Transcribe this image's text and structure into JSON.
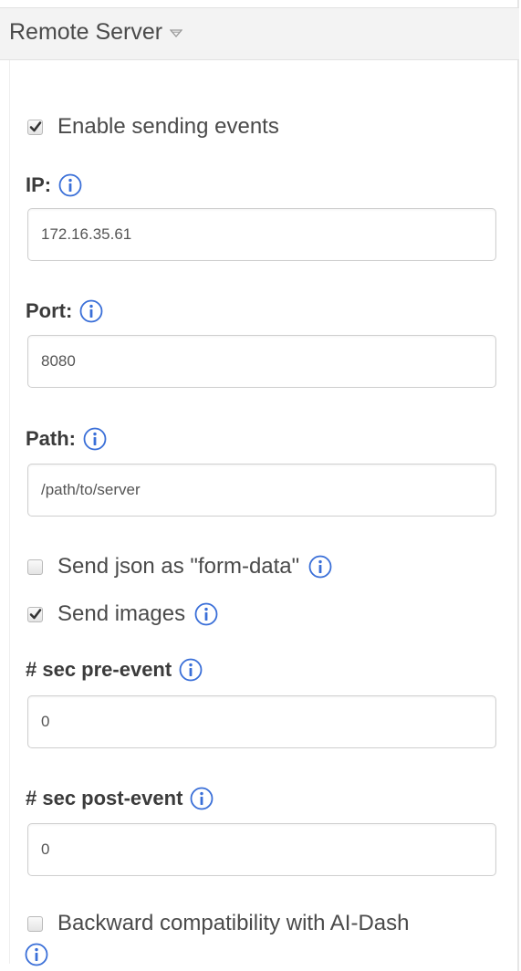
{
  "panel": {
    "title": "Remote Server",
    "caret_icon": "caret-down-icon"
  },
  "enable_sending": {
    "label": "Enable sending events",
    "checked": true
  },
  "ip": {
    "label": "IP:",
    "value": "172.16.35.61"
  },
  "port": {
    "label": "Port:",
    "value": "8080"
  },
  "path": {
    "label": "Path:",
    "value": "/path/to/server"
  },
  "send_json_form_data": {
    "label": "Send json as \"form-data\"",
    "checked": false
  },
  "send_images": {
    "label": "Send images",
    "checked": true
  },
  "sec_pre_event": {
    "label": "# sec pre-event",
    "value": "0"
  },
  "sec_post_event": {
    "label": "# sec post-event",
    "value": "0"
  },
  "backward_compat": {
    "label": "Backward compatibility with AI-Dash",
    "checked": false
  },
  "colors": {
    "info_icon": "#3a6fd8",
    "header_bg": "#f3f3f3",
    "border": "#cfcfcf"
  },
  "icons": {
    "info": "info-icon",
    "check": "checkmark-icon"
  }
}
